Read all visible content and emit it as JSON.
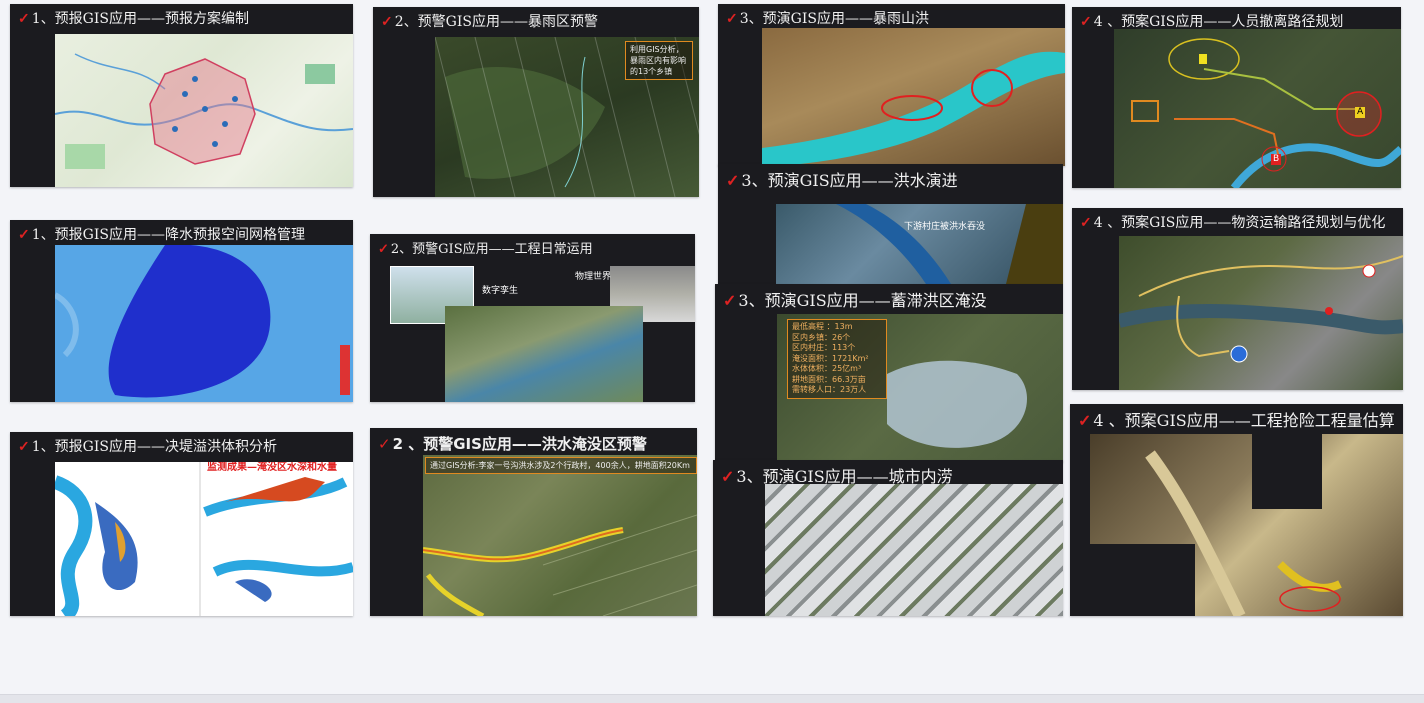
{
  "cards": [
    {
      "id": "c1",
      "check": "✓",
      "title": "1、预报GIS应用——预报方案编制"
    },
    {
      "id": "c2",
      "check": "✓",
      "title": "1、预报GIS应用——降水预报空间网格管理"
    },
    {
      "id": "c3",
      "check": "✓",
      "title": "1、预报GIS应用——决堤溢洪体积分析"
    },
    {
      "id": "c4",
      "check": "✓",
      "title": "2、预警GIS应用——暴雨区预警",
      "note": "利用GIS分析，暴雨区内有影响的13个乡镇"
    },
    {
      "id": "c5",
      "check": "✓",
      "title": "2、预警GIS应用——工程日常运用",
      "lbl1": "数字孪生",
      "lbl2": "物理世界"
    },
    {
      "id": "c6",
      "check": "✓",
      "title": "2 、预警GIS应用——洪水淹没区预警",
      "note": "通过GIS分析:李家一号沟洪水涉及2个行政村，400余人，耕地面积20Km"
    },
    {
      "id": "c7",
      "check": "✓",
      "title": "3、预演GIS应用——暴雨山洪"
    },
    {
      "id": "c8",
      "check": "✓",
      "title": "3、预演GIS应用——洪水演进",
      "lbl": "下游村庄被洪水吞没"
    },
    {
      "id": "c9",
      "check": "✓",
      "title": "3、预演GIS应用——蓄滞洪区淹没",
      "stats": [
        "最低高程 ：13m",
        "区内乡镇：26个",
        "区内村庄：113个",
        "淹没面积：1721Km²",
        "水体体积：25亿m³",
        "耕地面积：66.3万亩",
        "需转移人口：23万人"
      ]
    },
    {
      "id": "c10",
      "check": "✓",
      "title": "3、预演GIS应用——城市内涝"
    },
    {
      "id": "c11",
      "check": "✓",
      "title": "4 、预案GIS应用——人员撤离路径规划",
      "pinA": "A",
      "pinB": "B"
    },
    {
      "id": "c12",
      "check": "✓",
      "title": "4 、预案GIS应用——物资运输路径规划与优化"
    },
    {
      "id": "c13",
      "check": "✓",
      "title": "4 、预案GIS应用——工程抢险工程量估算"
    }
  ],
  "c3_panel_title": "监测成果—淹没区水深和水量",
  "colors": {
    "check": "#d22222",
    "title": "#f0f0f0",
    "card_bg": "#1b1b1f"
  }
}
